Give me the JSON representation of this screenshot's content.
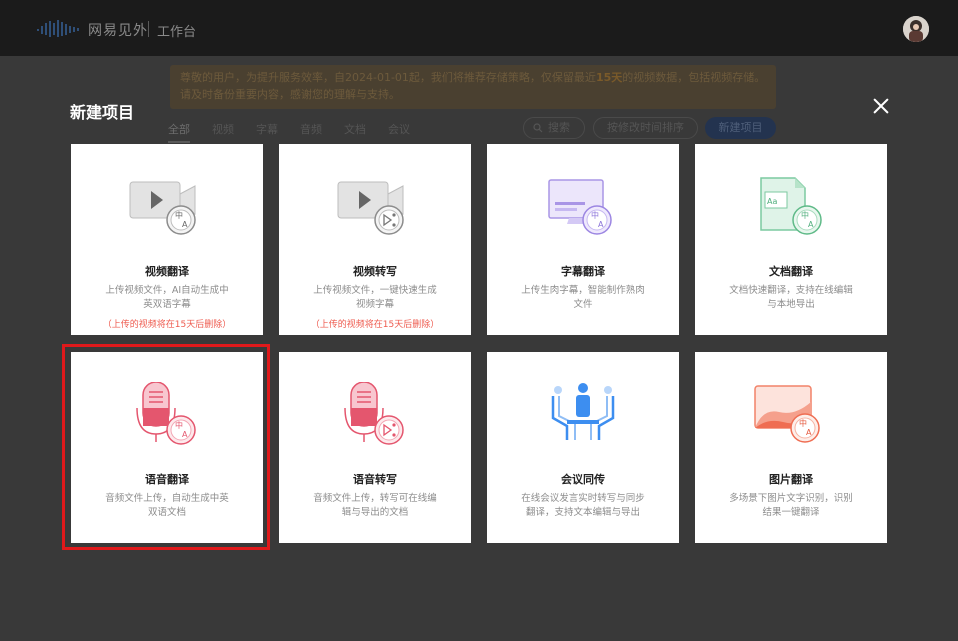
{
  "topbar": {
    "brand": "网易见外",
    "sub": "工作台"
  },
  "background": {
    "notice_prefix": "尊敬的用户，为提升服务效率，自2024-01-01起，我们将推荐存储策略，仅保留最近",
    "notice_bold": "15天",
    "notice_suffix": "的视频数据，包括视频存储。请及时备份重要内容，感谢您的理解与支持。",
    "filters": [
      "全部",
      "视频",
      "字幕",
      "音频",
      "文档",
      "会议"
    ],
    "search_label": "搜索",
    "sort_label": "按修改时间排序",
    "new_button": "新建项目"
  },
  "modal": {
    "title": "新建项目",
    "cards": [
      {
        "title": "视频翻译",
        "desc": "上传视频文件，AI自动生成中英双语字幕",
        "warn": "（上传的视频将在15天后删除）",
        "icon": "video-translate-icon"
      },
      {
        "title": "视频转写",
        "desc": "上传视频文件，一键快速生成视频字幕",
        "warn": "（上传的视频将在15天后删除）",
        "icon": "video-transcribe-icon"
      },
      {
        "title": "字幕翻译",
        "desc": "上传生肉字幕，智能制作熟肉文件",
        "warn": "",
        "icon": "subtitle-translate-icon"
      },
      {
        "title": "文档翻译",
        "desc": "文档快速翻译，支持在线编辑与本地导出",
        "warn": "",
        "icon": "document-translate-icon"
      },
      {
        "title": "语音翻译",
        "desc": "音频文件上传，自动生成中英双语文档",
        "warn": "",
        "icon": "audio-translate-icon"
      },
      {
        "title": "语音转写",
        "desc": "音频文件上传，转写可在线编辑与导出的文档",
        "warn": "",
        "icon": "audio-transcribe-icon"
      },
      {
        "title": "会议同传",
        "desc": "在线会议发言实时转写与同步翻译，支持文本编辑与导出",
        "warn": "",
        "icon": "meeting-interpret-icon"
      },
      {
        "title": "图片翻译",
        "desc": "多场景下图片文字识别，识别结果一键翻译",
        "warn": "",
        "icon": "image-translate-icon"
      }
    ]
  }
}
